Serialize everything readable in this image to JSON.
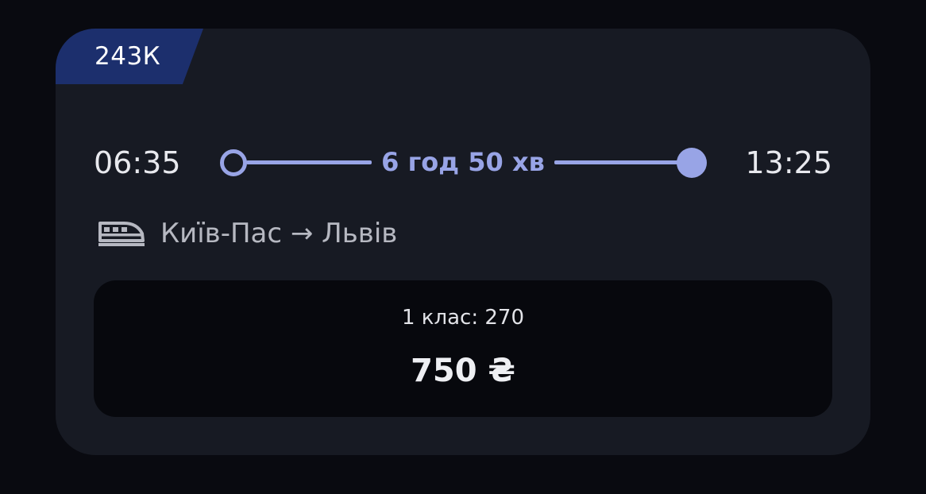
{
  "train": {
    "number": "243К"
  },
  "schedule": {
    "departure_time": "06:35",
    "arrival_time": "13:25",
    "duration": "6 год 50 хв"
  },
  "route": {
    "icon": "train-icon",
    "text": "Київ-Пас → Львів"
  },
  "price": {
    "class_seats": "1 клас: 270",
    "amount": "750 ₴"
  },
  "colors": {
    "background": "#090a10",
    "card": "#171a23",
    "badge": "#1c2f6d",
    "accent": "#98a4e6",
    "price_box": "#07080d"
  }
}
